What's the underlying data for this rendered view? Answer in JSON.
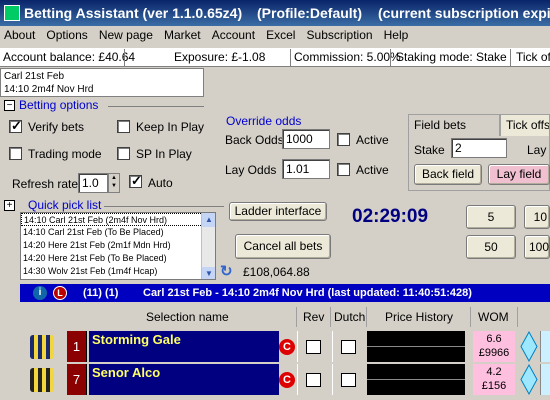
{
  "window": {
    "title_app": "Betting Assistant (ver 1.1.0.65z4)",
    "title_profile": "(Profile:Default)",
    "title_subscription": "(current subscription expire"
  },
  "menu": [
    "About",
    "Options",
    "New page",
    "Market",
    "Account",
    "Excel",
    "Subscription",
    "Help"
  ],
  "status": {
    "balance": "Account balance: £40.64",
    "exposure": "Exposure: £-1.08",
    "commission": "Commission: 5.00%",
    "staking": "Staking mode: Stake",
    "tick": "Tick off"
  },
  "race_tab": {
    "line1": "Carl 21st Feb",
    "line2": "14:10 2m4f Nov Hrd"
  },
  "betting_options": {
    "title": "Betting options",
    "verify_bets": {
      "label": "Verify bets",
      "checked": true
    },
    "keep_in_play": {
      "label": "Keep In Play",
      "checked": false
    },
    "trading_mode": {
      "label": "Trading mode",
      "checked": false
    },
    "sp_in_play": {
      "label": "SP In Play",
      "checked": false
    },
    "refresh_rate_label": "Refresh rate",
    "refresh_rate_value": "1.0",
    "auto": {
      "label": "Auto",
      "checked": true
    }
  },
  "override_odds": {
    "title": "Override odds",
    "back_label": "Back Odds",
    "back_value": "1000",
    "back_active": "Active",
    "lay_label": "Lay Odds",
    "lay_value": "1.01",
    "lay_active": "Active"
  },
  "field_bets": {
    "tab1": "Field bets",
    "tab2": "Tick offse",
    "stake_label": "Stake",
    "stake_value": "2",
    "lay_partial": "Lay o",
    "back_field": "Back field",
    "lay_field": "Lay field"
  },
  "quick_pick": {
    "title": "Quick pick list",
    "items": [
      "14:10 Carl 21st Feb (2m4f Nov Hrd)",
      "14:10 Carl 21st Feb (To Be Placed)",
      "14:20 Here 21st Feb (2m1f Mdn Hrd)",
      "14:20 Here 21st Feb (To Be Placed)",
      "14:30 Wolv 21st Feb (1m4f Hcap)"
    ]
  },
  "controls": {
    "ladder_interface": "Ladder interface",
    "cancel_all_bets": "Cancel all bets",
    "timer": "02:29:09",
    "liability": "£108,064.88",
    "stake_buttons": [
      "5",
      "10",
      "50",
      "100"
    ]
  },
  "event": {
    "info": "i",
    "L": "L",
    "counts": "(11) (1)",
    "title": "Carl 21st Feb - 14:10 2m4f Nov Hrd (last updated: 11:40:51:428)"
  },
  "grid_headers": {
    "selection": "Selection name",
    "rev": "Rev",
    "dutch": "Dutch",
    "price_history": "Price History",
    "wom": "WOM"
  },
  "runners": [
    {
      "number": "1",
      "name": "Storming Gale",
      "wom_odds": "6.6",
      "wom_amount": "£9966",
      "silk_colors": [
        "#1a2a6c",
        "#f2d640"
      ]
    },
    {
      "number": "7",
      "name": "Senor Alco",
      "wom_odds": "4.2",
      "wom_amount": "£156",
      "silk_colors": [
        "#222222",
        "#f2d640"
      ]
    }
  ],
  "colors": {
    "titlebar": "#0a246a",
    "event_bar": "#0000c0",
    "runner_number_bg": "#8b0000",
    "runner_name_bg": "#000080",
    "runner_name_text": "#ffff66",
    "wom_bg": "#ffc0e0",
    "timer": "#000080"
  }
}
